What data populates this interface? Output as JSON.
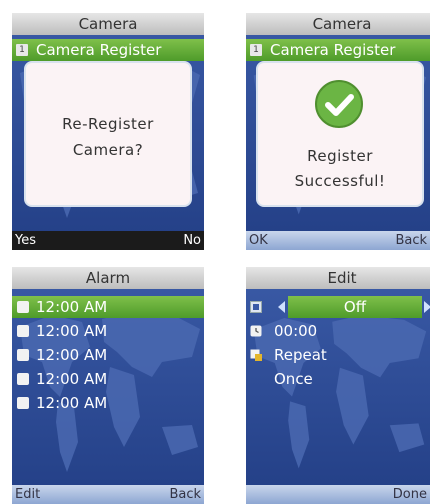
{
  "screens": {
    "register": {
      "title": "Camera",
      "menu_item": {
        "index": "1",
        "label": "Camera Register"
      },
      "dialog": {
        "line1": "Re-Register",
        "line2": "Camera?"
      },
      "softkeys": {
        "left": "Yes",
        "right": "No"
      }
    },
    "success": {
      "title": "Camera",
      "menu_item": {
        "index": "1",
        "label": "Camera Register"
      },
      "dialog": {
        "line1": "Register",
        "line2": "Successful!",
        "icon": "checkmark-circle-icon"
      },
      "softkeys": {
        "left": "OK",
        "right": "Back"
      }
    },
    "alarm": {
      "title": "Alarm",
      "items": [
        "12:00 AM",
        "12:00 AM",
        "12:00 AM",
        "12:00 AM",
        "12:00 AM"
      ],
      "softkeys": {
        "left": "Edit",
        "right": "Back"
      }
    },
    "edit": {
      "title": "Edit",
      "selector_value": "Off",
      "time": "00:00",
      "repeat_label": "Repeat",
      "repeat_value": "Once",
      "softkeys": {
        "left": "",
        "right": "Done"
      }
    }
  },
  "colors": {
    "accent_green": "#5fae35",
    "screen_blue": "#2f4f9a",
    "check_green": "#6bb544"
  }
}
